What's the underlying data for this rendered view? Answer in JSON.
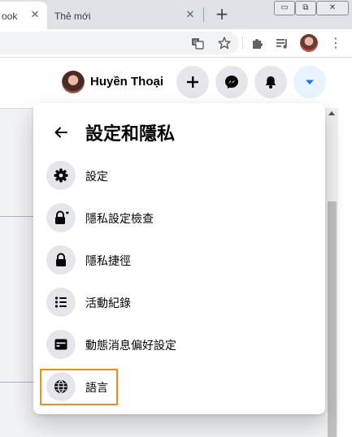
{
  "browser": {
    "tabs": [
      {
        "title": "ook",
        "active": true
      },
      {
        "title": "Thẻ mới",
        "active": false
      }
    ],
    "close_glyph": "✕",
    "new_tab_glyph": "+",
    "window_buttons": [
      "▭",
      "⧉",
      "✕"
    ],
    "toolbar_icons": [
      "translate-icon",
      "star-icon",
      "extensions-icon",
      "media-queue-icon",
      "profile-avatar",
      "menu-kebab-icon"
    ],
    "menu_glyph": "⋮"
  },
  "header": {
    "user_name": "Huyền Thoại",
    "buttons": [
      "create-icon",
      "messenger-icon",
      "notifications-icon",
      "account-menu-icon"
    ],
    "accent": "#1877f2"
  },
  "panel": {
    "title": "設定和隱私",
    "items": [
      {
        "label": "設定",
        "icon": "gear-icon"
      },
      {
        "label": "隱私設定檢查",
        "icon": "lock-heart-icon"
      },
      {
        "label": "隱私捷徑",
        "icon": "lock-icon"
      },
      {
        "label": "活動紀錄",
        "icon": "list-icon"
      },
      {
        "label": "動態消息偏好設定",
        "icon": "news-feed-icon"
      },
      {
        "label": "語言",
        "icon": "globe-icon"
      }
    ],
    "highlight_color": "#f28b1e"
  }
}
